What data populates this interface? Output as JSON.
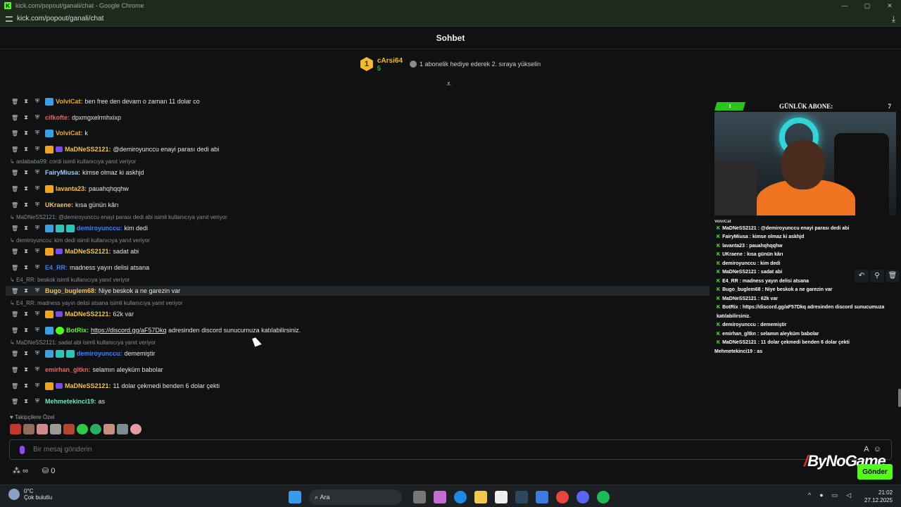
{
  "window": {
    "title": "kick.com/popout/ganali/chat - Google Chrome",
    "url": "kick.com/popout/ganali/chat",
    "minimize": "—",
    "restore": "▢",
    "close": "✕",
    "download_icon": "⤓"
  },
  "chat": {
    "title": "Sohbet"
  },
  "leaderboard": {
    "rank": "1",
    "user": "cArsi64",
    "count": "5",
    "text": "1 abonelik hediye ederek 2. sıraya yükselin"
  },
  "collapse_icon": "⩡",
  "messages": [
    {
      "user": "VolviCat",
      "color": "#f5a623",
      "text": "ben free den devam o zaman 11 dolar co"
    },
    {
      "user": "cifkofte",
      "color": "#ff5a5a",
      "text": "dpxmgxelrmhxixp"
    },
    {
      "user": "VolviCat",
      "color": "#f5a623",
      "text": "k"
    },
    {
      "user": "MaDNeSS2121",
      "color": "#f5c542",
      "text": "@demiroyunccu enayi parası dedi abi"
    },
    {
      "user": "FairyMiusa",
      "color": "#9ecbff",
      "text": "kimse olmaz ki askhjd",
      "reply": "ardababa99: cordi isimli kullanıcıya yanıt veriyor"
    },
    {
      "user": "lavanta23",
      "color": "#f5c542",
      "text": "pauahqhqqhw"
    },
    {
      "user": "UKraene",
      "color": "#f5c542",
      "text": "kısa günün kârı"
    },
    {
      "user": "demiroyunccu",
      "color": "#3b82f6",
      "text": "kim dedi",
      "reply": "MaDNeSS2121: @demiroyunccu enayi parası dedi abi isimli kullanıcıya yanıt veriyor"
    },
    {
      "user": "MaDNeSS2121",
      "color": "#f5c542",
      "text": "sadat abi",
      "reply": "demiroyunccu: kim dedi isimli kullanıcıya yanıt veriyor"
    },
    {
      "user": "E4_RR",
      "color": "#3b82f6",
      "text": "madness yayın delisi atsana"
    },
    {
      "user": "Bugo_buglem68",
      "color": "#f5c542",
      "text": "Niye beskok a ne garezin var",
      "reply": "E4_RR: beskok isimli kullanıcıya yanıt veriyor"
    },
    {
      "user": "MaDNeSS2121",
      "color": "#f5c542",
      "text": "62k var",
      "reply": "E4_RR: madness yayın delisi atsana isimli kullanıcıya yanıt veriyor"
    },
    {
      "user": "BotRix",
      "color": "#53fc18",
      "link": "https://discord.gg/aF57Dkq",
      "text": "adresinden discord sunucumuza katılabilirsiniz."
    },
    {
      "user": "demiroyunccu",
      "color": "#3b82f6",
      "text": "dememiştir",
      "reply": "MaDNeSS2121: sadat abi isimli kullanıcıya yanıt veriyor"
    },
    {
      "user": "emirhan_gltkn",
      "color": "#ff5a5a",
      "text": "selamın aleyküm babolar"
    },
    {
      "user": "MaDNeSS2121",
      "color": "#f5c542",
      "text": "11 dolar çekmedi benden 6 dolar çekti"
    },
    {
      "user": "Mehmetekinci19",
      "color": "#6ee7b7",
      "text": "as"
    }
  ],
  "overlay": {
    "header_badge": "1",
    "title": "GÜNLÜK ABONE:",
    "count": "7",
    "top_name": "VolviCat",
    "lines": [
      "MaDNeSS2121 : @demiroyunccu enayi parası dedi abi",
      "FairyMiusa : kimse olmaz ki askhjd",
      "lavanta23 : pauahqhqqhw",
      "UKraene : kısa günün kârı",
      "demiroyunccu : kim dedi",
      "MaDNeSS2121 : sadat abi",
      "E4_RR : madness yayın delisi atsana",
      "Bugo_buglem68 : Niye beskok a ne garezin var",
      "MaDNeSS2121 : 62k var",
      "BotRix : https://discord.gg/aF57Dkq adresinden discord sunucumuza",
      "katılabilirsiniz.",
      "demiroyunccu : dememiştir",
      "emirhan_gltkn : selamın aleyküm babolar",
      "MaDNeSS2121 : 11 dolar çekmedi benden 6 dolar çekti",
      "Mehmetekinci19 : as"
    ]
  },
  "followers_only": "Takipçilere Özel",
  "input": {
    "placeholder": "Bir mesaj gönderin",
    "send": "Gönder",
    "points": "0",
    "infinity": "∞"
  },
  "watermark": "ByNoGame",
  "taskbar": {
    "temp": "0°C",
    "weather": "Çok bulutlu",
    "search": "Ara",
    "time": "21:02",
    "date": "27.12.2025"
  }
}
